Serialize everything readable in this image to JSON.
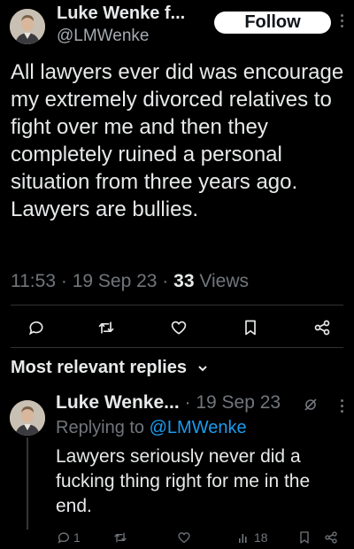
{
  "tweet": {
    "author_name": "Luke Wenke f...",
    "author_handle": "@LMWenke",
    "follow_label": "Follow",
    "text": "All lawyers ever did was encourage my extremely divorced relatives to fight over me and then they completely ruined a personal situation from three years ago.  Lawyers are bullies.",
    "time": "11:53",
    "date": "19 Sep 23",
    "views_count": "33",
    "views_label": "Views",
    "separator": "·"
  },
  "replies_section": {
    "sort_label": "Most relevant replies"
  },
  "reply": {
    "author_name": "Luke Wenke...",
    "separator": "·",
    "date": "19 Sep 23",
    "replying_prefix": "Replying to",
    "replying_handle": "@LMWenke",
    "text": "Lawyers seriously never did a fucking thing right for me in the end.",
    "reply_count": "1",
    "views_count": "18"
  },
  "colors": {
    "background": "#000000",
    "text_primary": "#e7e9ea",
    "text_secondary": "#71767b",
    "link": "#1d9bf0",
    "follow_bg": "#ffffff"
  },
  "icons": {
    "tweet_actions": [
      "reply-icon",
      "retweet-icon",
      "like-icon",
      "bookmark-icon",
      "share-icon"
    ],
    "reply_actions": [
      "reply-icon",
      "retweet-icon",
      "like-icon",
      "views-icon",
      "bookmark-icon",
      "share-icon"
    ]
  }
}
